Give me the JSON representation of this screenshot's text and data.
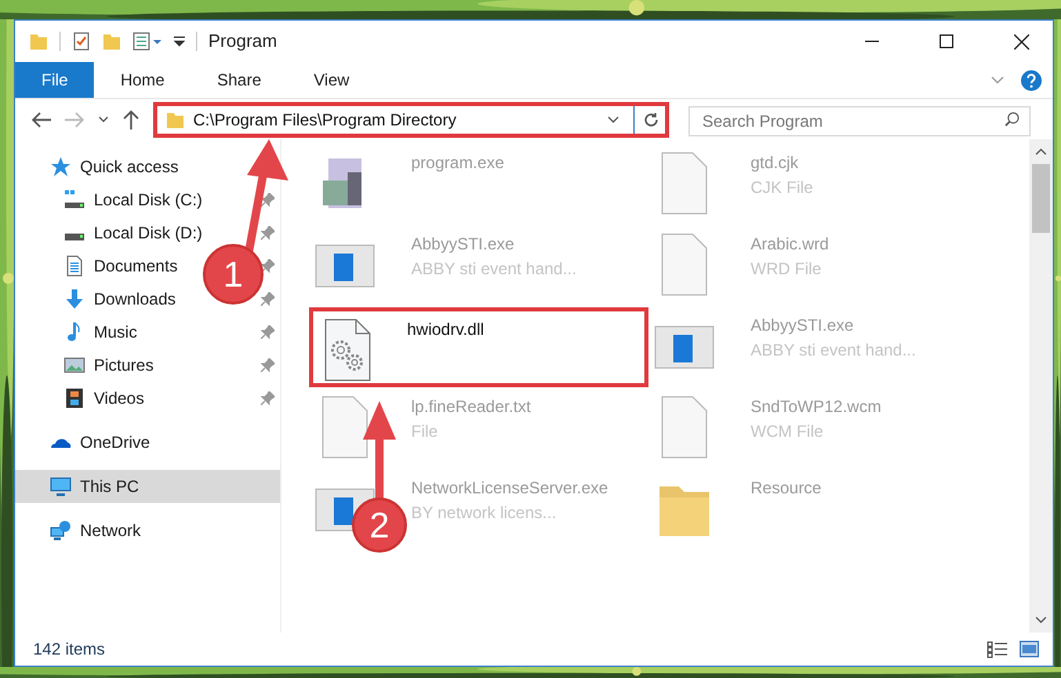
{
  "window": {
    "title": "Program"
  },
  "ribbon_tabs": [
    {
      "label": "File",
      "selected": true
    },
    {
      "label": "Home",
      "selected": false
    },
    {
      "label": "Share",
      "selected": false
    },
    {
      "label": "View",
      "selected": false
    }
  ],
  "address": {
    "path": "C:\\Program Files\\Program Directory",
    "highlighted": true
  },
  "search": {
    "placeholder": "Search Program"
  },
  "sidebar": {
    "items": [
      {
        "label": "Quick access",
        "kind": "star",
        "selected": false,
        "children": [
          {
            "label": "Local Disk (C:)",
            "kind": "sysdisk",
            "selected": false,
            "pinned": true
          },
          {
            "label": "Local Disk (D:)",
            "kind": "disk",
            "selected": false,
            "pinned": true
          },
          {
            "label": "Documents",
            "kind": "docs",
            "selected": false,
            "pinned": true
          },
          {
            "label": "Downloads",
            "kind": "download",
            "selected": false,
            "pinned": true
          },
          {
            "label": "Music",
            "kind": "music",
            "selected": false,
            "pinned": true
          },
          {
            "label": "Pictures",
            "kind": "pictures",
            "selected": false,
            "pinned": true
          },
          {
            "label": "Videos",
            "kind": "videos",
            "selected": false,
            "pinned": true
          }
        ]
      },
      {
        "label": "OneDrive",
        "kind": "cloud",
        "selected": false
      },
      {
        "label": "This PC",
        "kind": "pc",
        "selected": true
      },
      {
        "label": "Network",
        "kind": "network",
        "selected": false
      }
    ]
  },
  "files": [
    {
      "name": "program.exe",
      "kind": "setup",
      "highlighted": false
    },
    {
      "name": "gtd.cjk",
      "type": "CJK File",
      "kind": "blank",
      "highlighted": false
    },
    {
      "name": "AbbyySTI.exe",
      "type": "ABBY sti event hand...",
      "kind": "app",
      "highlighted": false
    },
    {
      "name": "Arabic.wrd",
      "type": "WRD File",
      "kind": "blank",
      "highlighted": false
    },
    {
      "name": "hwiodrv.dll",
      "kind": "dll",
      "highlighted": true
    },
    {
      "name": "AbbyySTI.exe",
      "type": "ABBY sti event hand...",
      "kind": "app",
      "highlighted": false
    },
    {
      "name": "lp.fineReader.txt",
      "type": "File",
      "kind": "blank",
      "highlighted": false
    },
    {
      "name": "SndToWP12.wcm",
      "type": "WCM File",
      "kind": "blank",
      "highlighted": false
    },
    {
      "name": "NetworkLicenseServer.exe",
      "type": "BY network licens...",
      "kind": "app",
      "highlighted": false
    },
    {
      "name": "Resource",
      "kind": "folder",
      "highlighted": false
    }
  ],
  "status_bar": {
    "count": "142 items"
  },
  "callouts": [
    {
      "label": "1"
    },
    {
      "label": "2"
    }
  ]
}
